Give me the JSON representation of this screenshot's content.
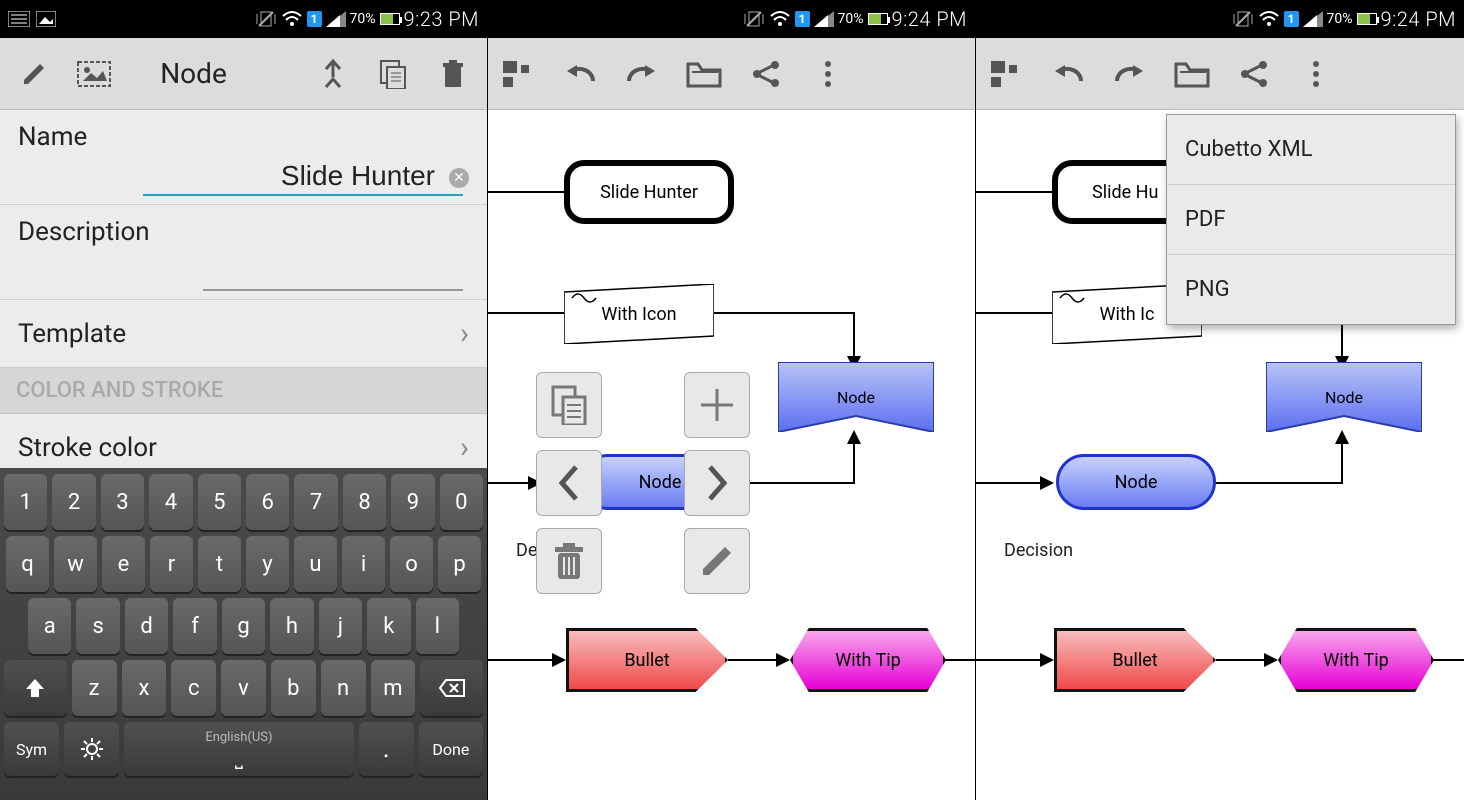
{
  "status": {
    "battery_pct": "70%",
    "times": [
      "9:23 PM",
      "9:24 PM",
      "9:24 PM"
    ]
  },
  "panel1": {
    "title": "Node",
    "rows": {
      "name_label": "Name",
      "name_value": "Slide Hunter",
      "description_label": "Description",
      "description_value": "",
      "template_label": "Template",
      "section_header": "COLOR AND STROKE",
      "stroke_label": "Stroke color"
    },
    "keyboard": {
      "row_num": [
        "1",
        "2",
        "3",
        "4",
        "5",
        "6",
        "7",
        "8",
        "9",
        "0"
      ],
      "row_q": [
        "q",
        "w",
        "e",
        "r",
        "t",
        "y",
        "u",
        "i",
        "o",
        "p"
      ],
      "row_a": [
        "a",
        "s",
        "d",
        "f",
        "g",
        "h",
        "j",
        "k",
        "l"
      ],
      "row_z": [
        "z",
        "x",
        "c",
        "v",
        "b",
        "n",
        "m"
      ],
      "shift": "⇧",
      "backspace": "⌫",
      "sym": "Sym",
      "gear": "⚙",
      "space_lang": "English(US)",
      "space_sym": "⌴",
      "period": ".",
      "done": "Done"
    }
  },
  "canvas_nodes": {
    "slide_hunter": "Slide Hunter",
    "with_icon": "With Icon",
    "node": "Node",
    "decision": "Decision",
    "bullet": "Bullet",
    "with_tip": "With Tip"
  },
  "dropdown": {
    "xml": "Cubetto XML",
    "pdf": "PDF",
    "png": "PNG"
  },
  "icons": {
    "pencil": "pencil-icon",
    "image": "image-icon",
    "merge": "merge-icon",
    "copy": "copy-icon",
    "trash": "trash-icon",
    "grid": "grid-icon",
    "undo": "undo-icon",
    "redo": "redo-icon",
    "folder": "folder-icon",
    "share": "share-icon",
    "overflow": "overflow-icon",
    "plus": "plus-icon",
    "chev_left": "chevron-left-icon",
    "chev_right": "chevron-right-icon"
  }
}
